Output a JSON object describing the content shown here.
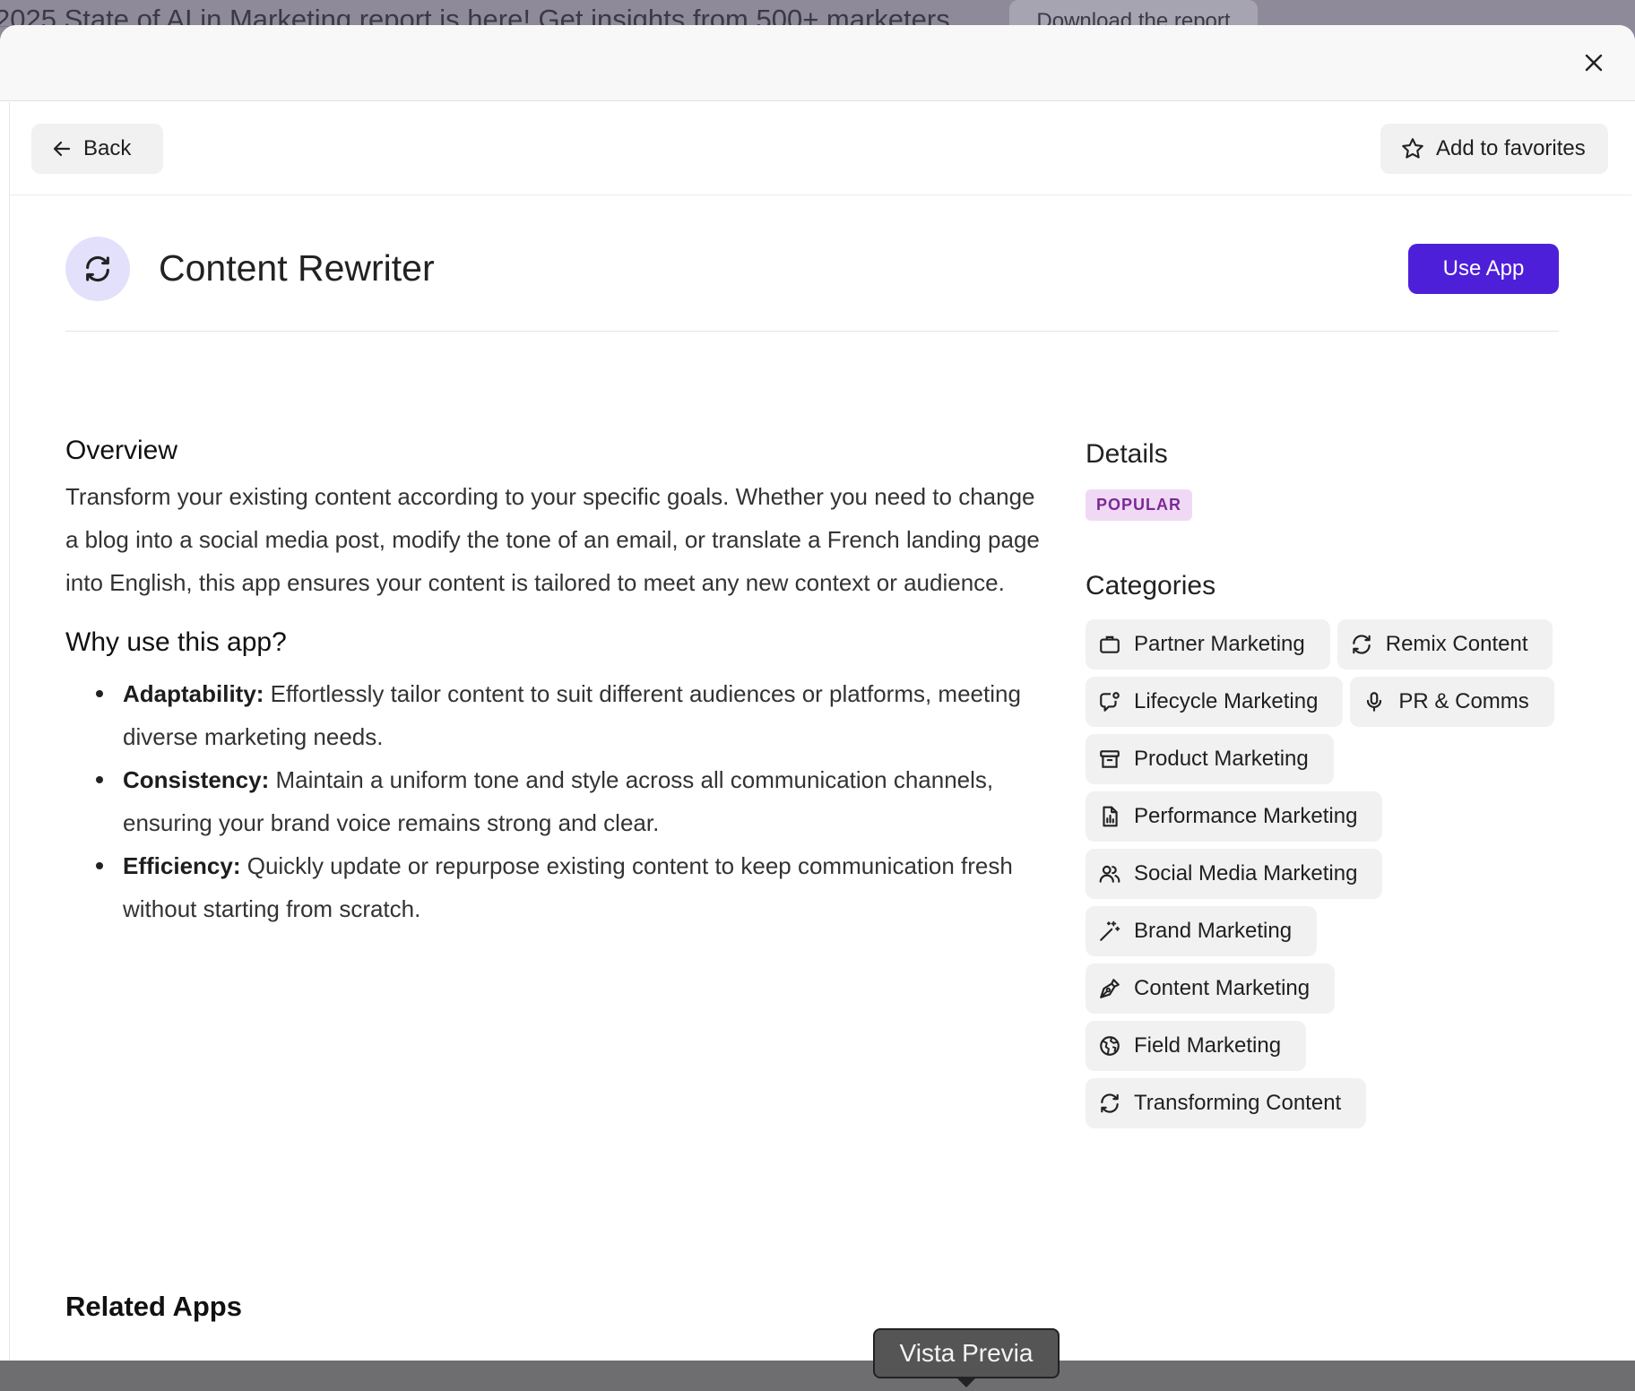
{
  "banner": {
    "text": "2025 State of AI in Marketing report is here! Get insights from 500+ marketers",
    "button_label": "Download the report"
  },
  "toolbar": {
    "back_label": "Back",
    "favorites_label": "Add to favorites"
  },
  "app": {
    "title": "Content Rewriter",
    "use_label": "Use App"
  },
  "overview": {
    "heading": "Overview",
    "text": "Transform your existing content according to your specific goals. Whether you need to change a blog into a social media post, modify the tone of an email, or translate a French landing page into English, this app ensures your content is tailored to meet any new context or audience."
  },
  "why": {
    "heading": "Why use this app?",
    "items": [
      {
        "title": "Adaptability:",
        "text": " Effortlessly tailor content to suit different audiences or platforms, meeting diverse marketing needs."
      },
      {
        "title": "Consistency:",
        "text": " Maintain a uniform tone and style across all communication channels, ensuring your brand voice remains strong and clear."
      },
      {
        "title": "Efficiency:",
        "text": " Quickly update or repurpose existing content to keep communication fresh without starting from scratch."
      }
    ]
  },
  "details": {
    "heading": "Details",
    "badge": "POPULAR"
  },
  "categories": {
    "heading": "Categories",
    "items": [
      {
        "label": "Partner Marketing",
        "icon": "briefcase-icon"
      },
      {
        "label": "Remix Content",
        "icon": "refresh-icon"
      },
      {
        "label": "Lifecycle Marketing",
        "icon": "chat-bubble-icon"
      },
      {
        "label": "PR & Comms",
        "icon": "microphone-icon"
      },
      {
        "label": "Product Marketing",
        "icon": "archive-box-icon"
      },
      {
        "label": "Performance Marketing",
        "icon": "chart-document-icon"
      },
      {
        "label": "Social Media Marketing",
        "icon": "users-icon"
      },
      {
        "label": "Brand Marketing",
        "icon": "magic-wand-icon"
      },
      {
        "label": "Content Marketing",
        "icon": "pen-nib-icon"
      },
      {
        "label": "Field Marketing",
        "icon": "globe-icon"
      },
      {
        "label": "Transforming Content",
        "icon": "refresh-icon"
      }
    ]
  },
  "related": {
    "heading": "Related Apps"
  },
  "tooltip": {
    "text": "Vista Previa"
  },
  "colors": {
    "accent": "#4e1fd9",
    "badge_bg": "#f0d9f5",
    "badge_text": "#7b2a94",
    "app_icon_bg": "#e3e0fb"
  }
}
